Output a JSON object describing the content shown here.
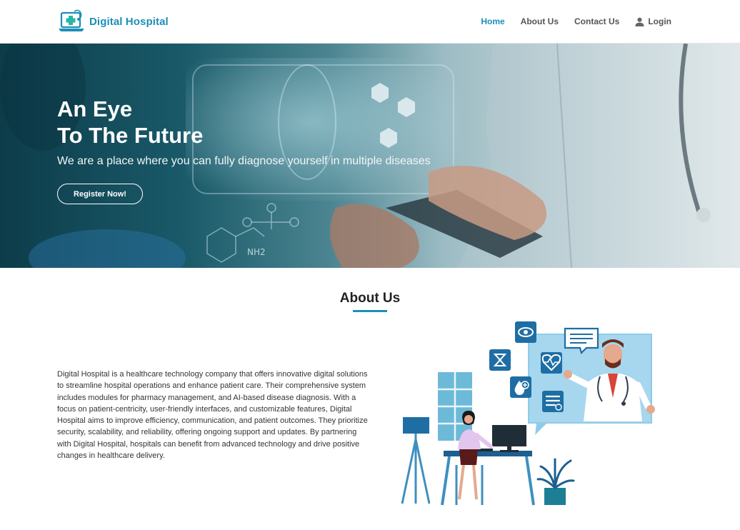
{
  "brand": {
    "name": "Digital Hospital"
  },
  "nav": {
    "items": [
      {
        "label": "Home",
        "active": true
      },
      {
        "label": "About Us"
      },
      {
        "label": "Contact Us"
      }
    ],
    "login_label": "Login"
  },
  "hero": {
    "title_line1": "An Eye",
    "title_line2": "To The Future",
    "subtitle": "We are a place where you can fully diagnose yourself in multiple diseases",
    "cta_label": "Register Now!",
    "graphic_texts": {
      "formula": "NH2"
    }
  },
  "about": {
    "title": "About Us",
    "body": "Digital Hospital is a healthcare technology company that offers innovative digital solutions to streamline hospital operations and enhance patient care. Their comprehensive system includes modules for pharmacy management, and AI-based disease diagnosis. With a focus on patient-centricity, user-friendly interfaces, and customizable features, Digital Hospital aims to improve efficiency, communication, and patient outcomes. They prioritize security, scalability, and reliability, offering ongoing support and updates. By partnering with Digital Hospital, hospitals can benefit from advanced technology and drive positive changes in healthcare delivery."
  },
  "colors": {
    "accent": "#1c8fb8",
    "text": "#333333",
    "hero_dark": "#0d3c4a"
  },
  "icons": [
    "laptop-medical-logo-icon",
    "user-icon",
    "eye-icon",
    "chat-icon",
    "hourglass-icon",
    "heart-pulse-icon",
    "blood-drop-icon",
    "intestine-icon"
  ]
}
